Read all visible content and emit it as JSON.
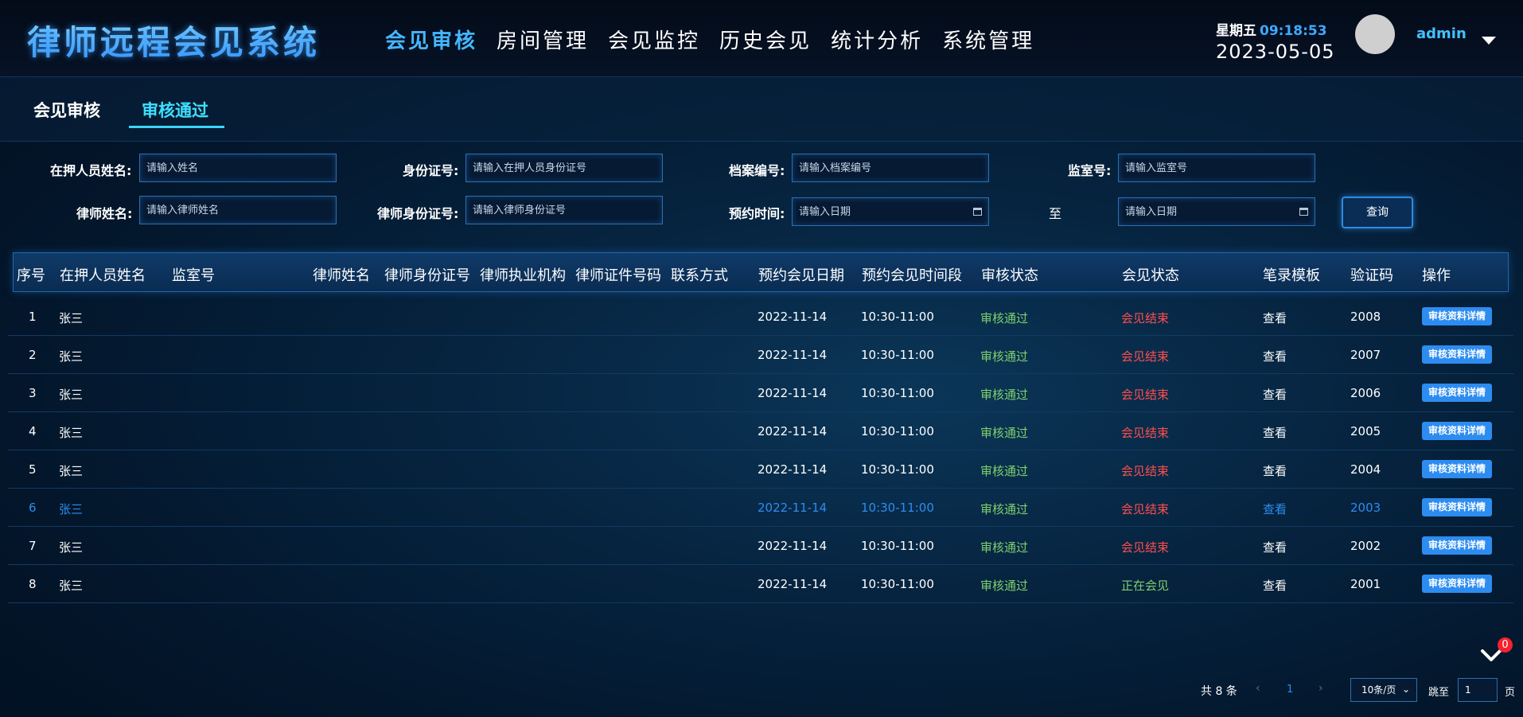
{
  "app": {
    "title": "律师远程会见系统"
  },
  "nav": {
    "items": [
      {
        "label": "会见审核",
        "active": true
      },
      {
        "label": "房间管理",
        "active": false
      },
      {
        "label": "会见监控",
        "active": false
      },
      {
        "label": "历史会见",
        "active": false
      },
      {
        "label": "统计分析",
        "active": false
      },
      {
        "label": "系统管理",
        "active": false
      }
    ]
  },
  "datetime": {
    "weekday": "星期五",
    "time": "09:18:53",
    "date": "2023-05-05"
  },
  "user": {
    "name": "admin"
  },
  "subtabs": [
    {
      "label": "会见审核",
      "active": false
    },
    {
      "label": "审核通过",
      "active": true
    }
  ],
  "filters": {
    "detainee_name": {
      "label": "在押人员姓名:",
      "placeholder": "请输入姓名"
    },
    "id_number": {
      "label": "身份证号:",
      "placeholder": "请输入在押人员身份证号"
    },
    "file_number": {
      "label": "档案编号:",
      "placeholder": "请输入档案编号"
    },
    "cell_number": {
      "label": "监室号:",
      "placeholder": "请输入监室号"
    },
    "lawyer_name": {
      "label": "律师姓名:",
      "placeholder": "请输入律师姓名"
    },
    "lawyer_id": {
      "label": "律师身份证号:",
      "placeholder": "请输入律师身份证号"
    },
    "appointment_time": {
      "label": "预约时间:",
      "start_placeholder": "请输入日期",
      "to_label": "至",
      "end_placeholder": "请输入日期"
    },
    "query_label": "查询"
  },
  "table": {
    "columns": [
      "序号",
      "在押人员姓名",
      "监室号",
      "律师姓名",
      "律师身份证号",
      "律师执业机构",
      "律师证件号码",
      "联系方式",
      "预约会见日期",
      "预约会见时间段",
      "审核状态",
      "会见状态",
      "笔录模板",
      "验证码",
      "操作"
    ],
    "rows": [
      {
        "index": "1",
        "name": "张三",
        "date": "2022-11-14",
        "period": "10:30-11:00",
        "audit": "审核通过",
        "meeting": "会见结束",
        "template": "查看",
        "code": "2008",
        "action": "审核资料详情"
      },
      {
        "index": "2",
        "name": "张三",
        "date": "2022-11-14",
        "period": "10:30-11:00",
        "audit": "审核通过",
        "meeting": "会见结束",
        "template": "查看",
        "code": "2007",
        "action": "审核资料详情"
      },
      {
        "index": "3",
        "name": "张三",
        "date": "2022-11-14",
        "period": "10:30-11:00",
        "audit": "审核通过",
        "meeting": "会见结束",
        "template": "查看",
        "code": "2006",
        "action": "审核资料详情"
      },
      {
        "index": "4",
        "name": "张三",
        "date": "2022-11-14",
        "period": "10:30-11:00",
        "audit": "审核通过",
        "meeting": "会见结束",
        "template": "查看",
        "code": "2005",
        "action": "审核资料详情"
      },
      {
        "index": "5",
        "name": "张三",
        "date": "2022-11-14",
        "period": "10:30-11:00",
        "audit": "审核通过",
        "meeting": "会见结束",
        "template": "查看",
        "code": "2004",
        "action": "审核资料详情"
      },
      {
        "index": "6",
        "name": "张三",
        "date": "2022-11-14",
        "period": "10:30-11:00",
        "audit": "审核通过",
        "meeting": "会见结束",
        "template": "查看",
        "code": "2003",
        "action": "审核资料详情",
        "highlighted": true
      },
      {
        "index": "7",
        "name": "张三",
        "date": "2022-11-14",
        "period": "10:30-11:00",
        "audit": "审核通过",
        "meeting": "会见结束",
        "template": "查看",
        "code": "2002",
        "action": "审核资料详情"
      },
      {
        "index": "8",
        "name": "张三",
        "date": "2022-11-14",
        "period": "10:30-11:00",
        "audit": "审核通过",
        "meeting": "正在会见",
        "template": "查看",
        "code": "2001",
        "action": "审核资料详情"
      }
    ]
  },
  "notification": {
    "count": "0"
  },
  "pagination": {
    "total_label": "共 8 条",
    "prev": "‹",
    "current_page": "1",
    "next": "›",
    "page_size": "10条/页",
    "jump_label": "跳至",
    "jump_value": "1",
    "page_word": "页"
  },
  "colors": {
    "accent": "#2d8cf0",
    "pass": "#7fd06b",
    "ended": "#ff4d4f",
    "title": "#45b6ff"
  }
}
